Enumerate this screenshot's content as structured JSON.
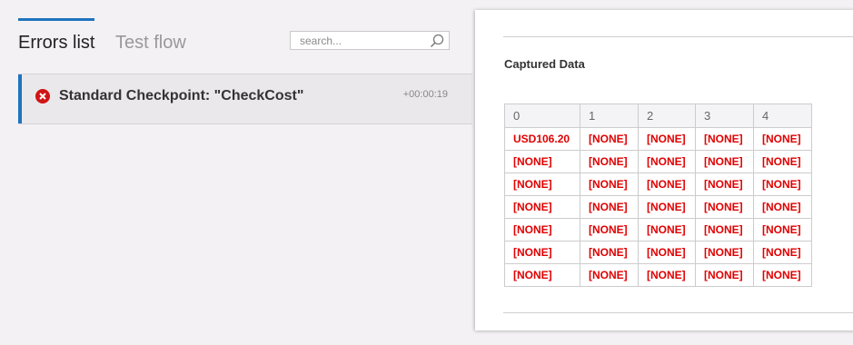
{
  "tabs": {
    "errors_list": "Errors list",
    "test_flow": "Test flow"
  },
  "search": {
    "placeholder": "search...",
    "value": ""
  },
  "errors": [
    {
      "title": "Standard Checkpoint: \"CheckCost\"",
      "time": "+00:00:19",
      "icon": "error-icon"
    }
  ],
  "details": {
    "heading": "Captured Data",
    "columns": [
      "0",
      "1",
      "2",
      "3",
      "4"
    ],
    "rows": [
      [
        "USD106.20",
        "[NONE]",
        "[NONE]",
        "[NONE]",
        "[NONE]"
      ],
      [
        "[NONE]",
        "[NONE]",
        "[NONE]",
        "[NONE]",
        "[NONE]"
      ],
      [
        "[NONE]",
        "[NONE]",
        "[NONE]",
        "[NONE]",
        "[NONE]"
      ],
      [
        "[NONE]",
        "[NONE]",
        "[NONE]",
        "[NONE]",
        "[NONE]"
      ],
      [
        "[NONE]",
        "[NONE]",
        "[NONE]",
        "[NONE]",
        "[NONE]"
      ],
      [
        "[NONE]",
        "[NONE]",
        "[NONE]",
        "[NONE]",
        "[NONE]"
      ],
      [
        "[NONE]",
        "[NONE]",
        "[NONE]",
        "[NONE]",
        "[NONE]"
      ]
    ]
  },
  "colors": {
    "accent": "#1e73be",
    "error": "#e00000",
    "error_icon": "#d11414"
  }
}
